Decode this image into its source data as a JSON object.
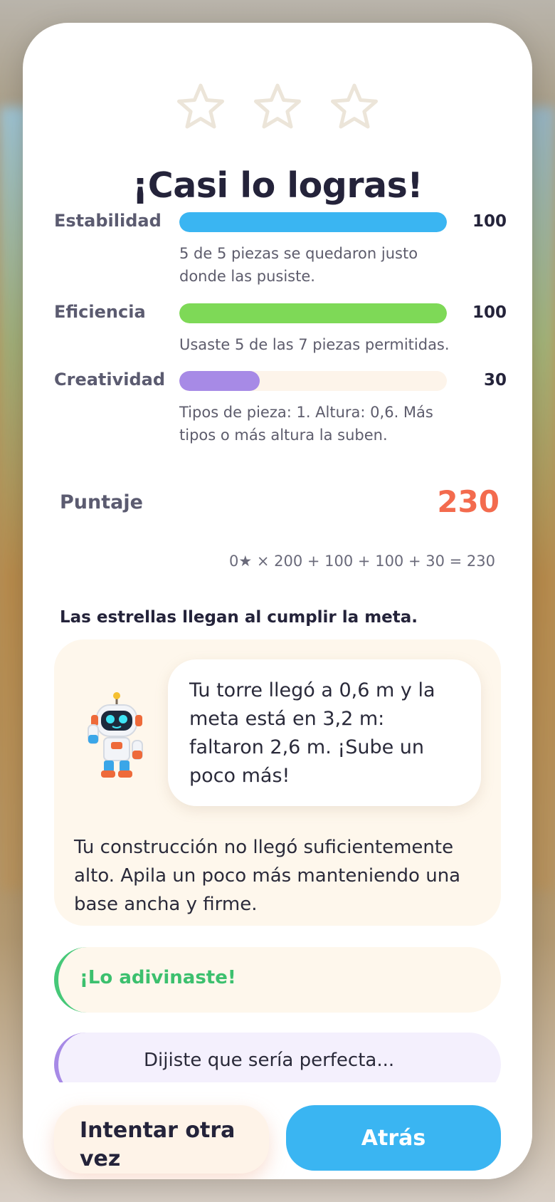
{
  "title": "¡Casi lo logras!",
  "stars": {
    "earned": 0,
    "total": 3,
    "icon": "star-outline-icon",
    "color": "#ece5d9"
  },
  "metrics": [
    {
      "label": "Estabilidad",
      "value": "100",
      "fraction": 1.0,
      "color": "#3ab5f2",
      "description": "5 de 5 piezas se quedaron justo donde las pusiste."
    },
    {
      "label": "Eficiencia",
      "value": "100",
      "fraction": 1.0,
      "color": "#7ed957",
      "description": "Usaste 5 de las 7 piezas permitidas."
    },
    {
      "label": "Creatividad",
      "value": "30",
      "fraction": 0.3,
      "color": "#a78ae6",
      "description": "Tipos de pieza: 1. Altura: 0,6. Más tipos o más altura la suben."
    }
  ],
  "score": {
    "label": "Puntaje",
    "value": "230",
    "formula": "0★ × 200 + 100 + 100 + 30 = 230"
  },
  "stars_note": "Las estrellas llegan al cumplir la meta.",
  "feedback": {
    "robot_icon": "robot-mascot-icon",
    "bubble": "Tu torre llegó a 0,6 m y la meta está en 3,2 m: faltaron 2,6 m. ¡Sube un poco más!",
    "text": "Tu construcción no llegó suficientemente alto. Apila un poco más manteniendo una base ancha y firme."
  },
  "guess": {
    "text": "¡Lo adivinaste!"
  },
  "peek": {
    "text": "Dijiste que sería perfecta..."
  },
  "buttons": {
    "retry": "Intentar otra vez",
    "back": "Atrás"
  }
}
